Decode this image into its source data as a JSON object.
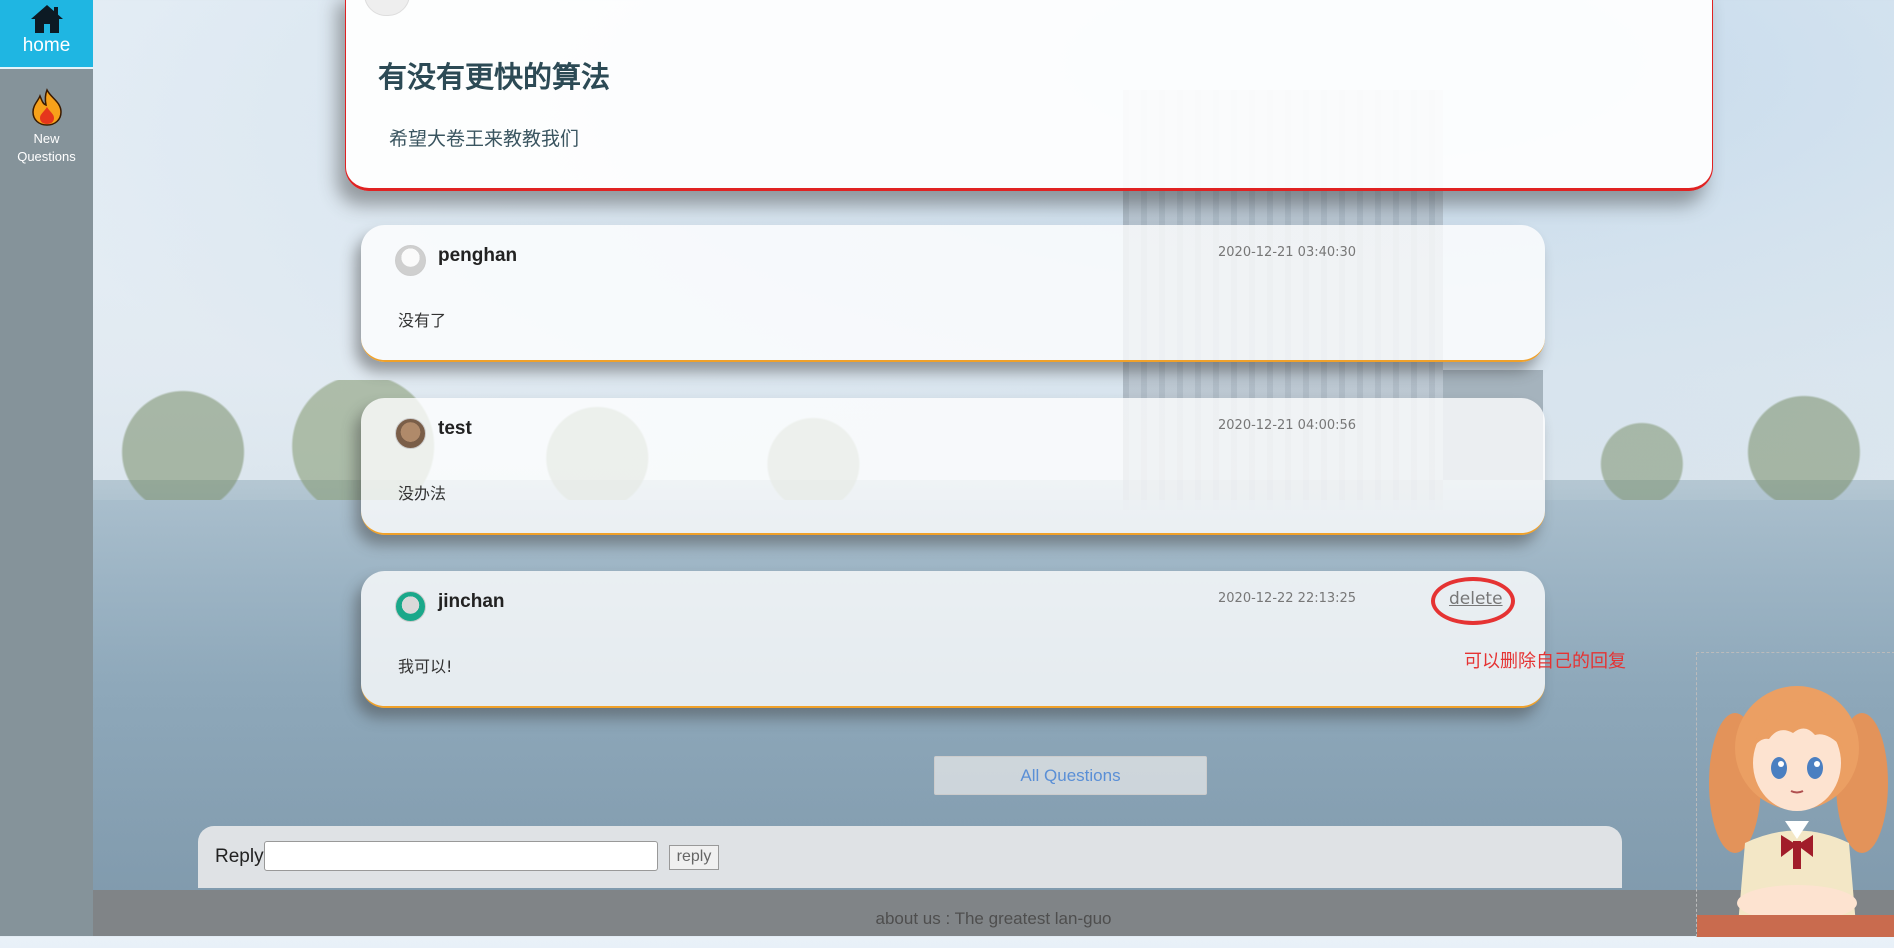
{
  "sidebar": {
    "home_label": "home",
    "new_label_line1": "New",
    "new_label_line2": "Questions"
  },
  "question": {
    "title": "有没有更快的算法",
    "body": "希望大卷王来教教我们"
  },
  "answers": [
    {
      "user": "penghan",
      "time": "2020-12-21 03:40:30",
      "text": "没有了"
    },
    {
      "user": "test",
      "time": "2020-12-21 04:00:56",
      "text": "没办法"
    },
    {
      "user": "jinchan",
      "time": "2020-12-22 22:13:25",
      "text": "我可以!",
      "delete_label": "delete"
    }
  ],
  "annotation": "可以删除自己的回复",
  "all_questions_label": "All Questions",
  "reply": {
    "label": "Reply",
    "value": "",
    "button": "reply"
  },
  "footer": "about us : The greatest lan-guo",
  "colors": {
    "accent": "#1fb6e2",
    "question_border": "#e02222",
    "answer_border": "#f0a12a",
    "annotation": "#e53333"
  }
}
